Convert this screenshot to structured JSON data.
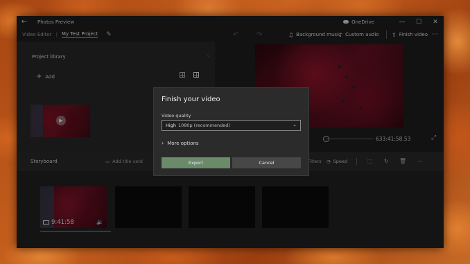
{
  "app": {
    "title": "Photos Preview",
    "onedrive_label": "OneDrive"
  },
  "toolbar": {
    "breadcrumb_root": "Video Editor",
    "project_name": "My Test Project",
    "background_music": "Background music",
    "custom_audio": "Custom audio",
    "finish_video": "Finish video"
  },
  "library": {
    "title": "Project library",
    "add_label": "Add"
  },
  "preview": {
    "time": "633:41:58.53"
  },
  "storyboard": {
    "title": "Storyboard",
    "add_title_card": "Add title card",
    "filters": "Filters",
    "speed": "Speed",
    "clip_duration": "9:41:58"
  },
  "dialog": {
    "title": "Finish your video",
    "quality_label": "Video quality",
    "quality_value_main": "High",
    "quality_value_detail": "1080p (recommended)",
    "more_options": "More options",
    "export_button": "Export",
    "cancel_button": "Cancel"
  },
  "colors": {
    "accent_export": "#6a8a6a",
    "window_bg": "#1c1c1c",
    "dialog_bg": "#2b2b2b"
  }
}
